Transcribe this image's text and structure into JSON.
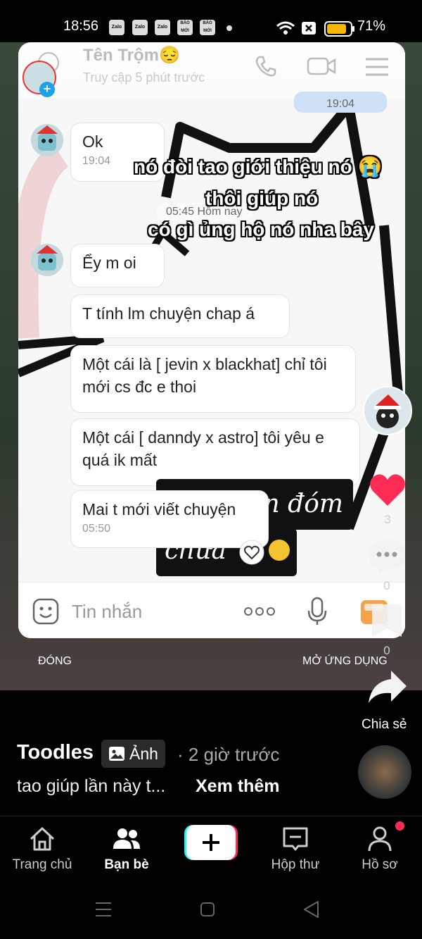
{
  "status_bar": {
    "time": "18:56",
    "notification_icons": [
      "Zalo",
      "Zalo",
      "Zalo",
      "BÁO MỚI",
      "BÁO MỚI"
    ],
    "battery": "71%"
  },
  "chat": {
    "header": {
      "name": "Tên Trộm😔",
      "subtitle": "Truy cập 5 phút trước"
    },
    "my_time": "19:04",
    "messages": [
      {
        "text": "Ok",
        "time": "19:04"
      },
      {
        "text": "Ểy m oi",
        "time": ""
      },
      {
        "text": "T tính lm chuyện chap á",
        "time": ""
      },
      {
        "text": "Một cái là [ jevin x blackhat] chỉ tôi mới cs đc e thoi",
        "time": ""
      },
      {
        "text": "Một cái [ danndy x astro] tôi yêu e quá ik mất",
        "time": ""
      },
      {
        "text": "Mai t mới viết chuyện",
        "time": "05:50"
      }
    ],
    "separator": "05:45 Hôm nay",
    "input_placeholder": "Tin nhắn",
    "sticker_text": [
      "n đóm",
      "chưa"
    ]
  },
  "captions": [
    "nó đòi tao giới thiệu nó 😭",
    "thôi giúp nó",
    "có gì ủng hộ nó nha bây"
  ],
  "overlay": {
    "close_label": "ĐÓNG",
    "open_app_label": "MỞ ỨNG DỤNG"
  },
  "actions": {
    "likes": "3",
    "comments": "0",
    "saves": "0",
    "share_label": "Chia sẻ"
  },
  "post": {
    "author": "Toodles",
    "type_badge": "Ảnh",
    "time": "· 2 giờ trước",
    "description": "tao giúp lần này t...",
    "see_more": "Xem thêm"
  },
  "tabs": [
    {
      "label": "Trang chủ",
      "icon": "home-icon"
    },
    {
      "label": "Bạn bè",
      "icon": "friends-icon"
    },
    {
      "label": "",
      "icon": "create-icon"
    },
    {
      "label": "Hộp thư",
      "icon": "inbox-icon"
    },
    {
      "label": "Hồ sơ",
      "icon": "profile-icon"
    }
  ],
  "colors": {
    "like_red": "#fe2c55",
    "my_bubble": "#cfe1f6",
    "tiktok_cyan": "#25f4ee",
    "tiktok_pink": "#fe2c55"
  }
}
